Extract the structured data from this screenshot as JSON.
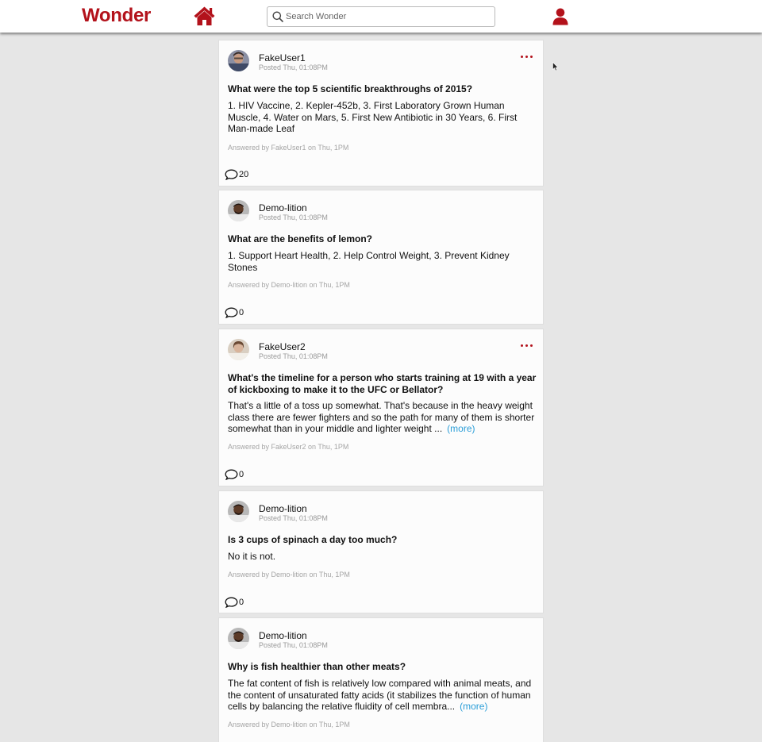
{
  "app": {
    "logo": "Wonder",
    "search_placeholder": "Search Wonder",
    "brand_color": "#b3121b",
    "link_color": "#2b9ed8"
  },
  "icons": {
    "home": "home-icon",
    "search": "search-icon",
    "user": "user-icon",
    "menu": "more-options-icon",
    "comment": "comment-icon"
  },
  "feed": [
    {
      "author": "FakeUser1",
      "posted": "Posted Thu, 01:08PM",
      "question": "What were the top 5 scientific breakthroughs of 2015?",
      "answer": "1. HIV Vaccine, 2. Kepler-452b, 3. First Laboratory Grown Human Muscle, 4. Water on Mars, 5. First New Antibiotic in 30 Years, 6. First Man-made Leaf",
      "more": "",
      "answered_by": "Answered by FakeUser1 on Thu, 1PM",
      "comment_count": "20"
    },
    {
      "author": "Demo-lition",
      "posted": "Posted Thu, 01:08PM",
      "question": "What are the benefits of lemon?",
      "answer": "1. Support Heart Health, 2. Help Control Weight, 3. Prevent Kidney Stones",
      "more": "",
      "answered_by": "Answered by Demo-lition on Thu, 1PM",
      "comment_count": "0"
    },
    {
      "author": "FakeUser2",
      "posted": "Posted Thu, 01:08PM",
      "question": "What's the timeline for a person who starts training at 19 with a year of kickboxing to make it to the UFC or Bellator?",
      "answer": "That's a little of a toss up somewhat. That's because in the heavy weight class there are fewer fighters and so the path for many of them is shorter somewhat than in your middle and lighter weight ...",
      "more": "(more)",
      "answered_by": "Answered by FakeUser2 on Thu, 1PM",
      "comment_count": "0"
    },
    {
      "author": "Demo-lition",
      "posted": "Posted Thu, 01:08PM",
      "question": "Is 3 cups of spinach a day too much?",
      "answer": "No it is not.",
      "more": "",
      "answered_by": "Answered by Demo-lition on Thu, 1PM",
      "comment_count": "0"
    },
    {
      "author": "Demo-lition",
      "posted": "Posted Thu, 01:08PM",
      "question": "Why is fish healthier than other meats?",
      "answer": "The fat content of fish is relatively low compared with animal meats, and the content of unsaturated fatty acids (it stabilizes the function of human cells by balancing the relative fluidity of cell membra...",
      "more": "(more)",
      "answered_by": "Answered by Demo-lition on Thu, 1PM",
      "comment_count": ""
    }
  ]
}
